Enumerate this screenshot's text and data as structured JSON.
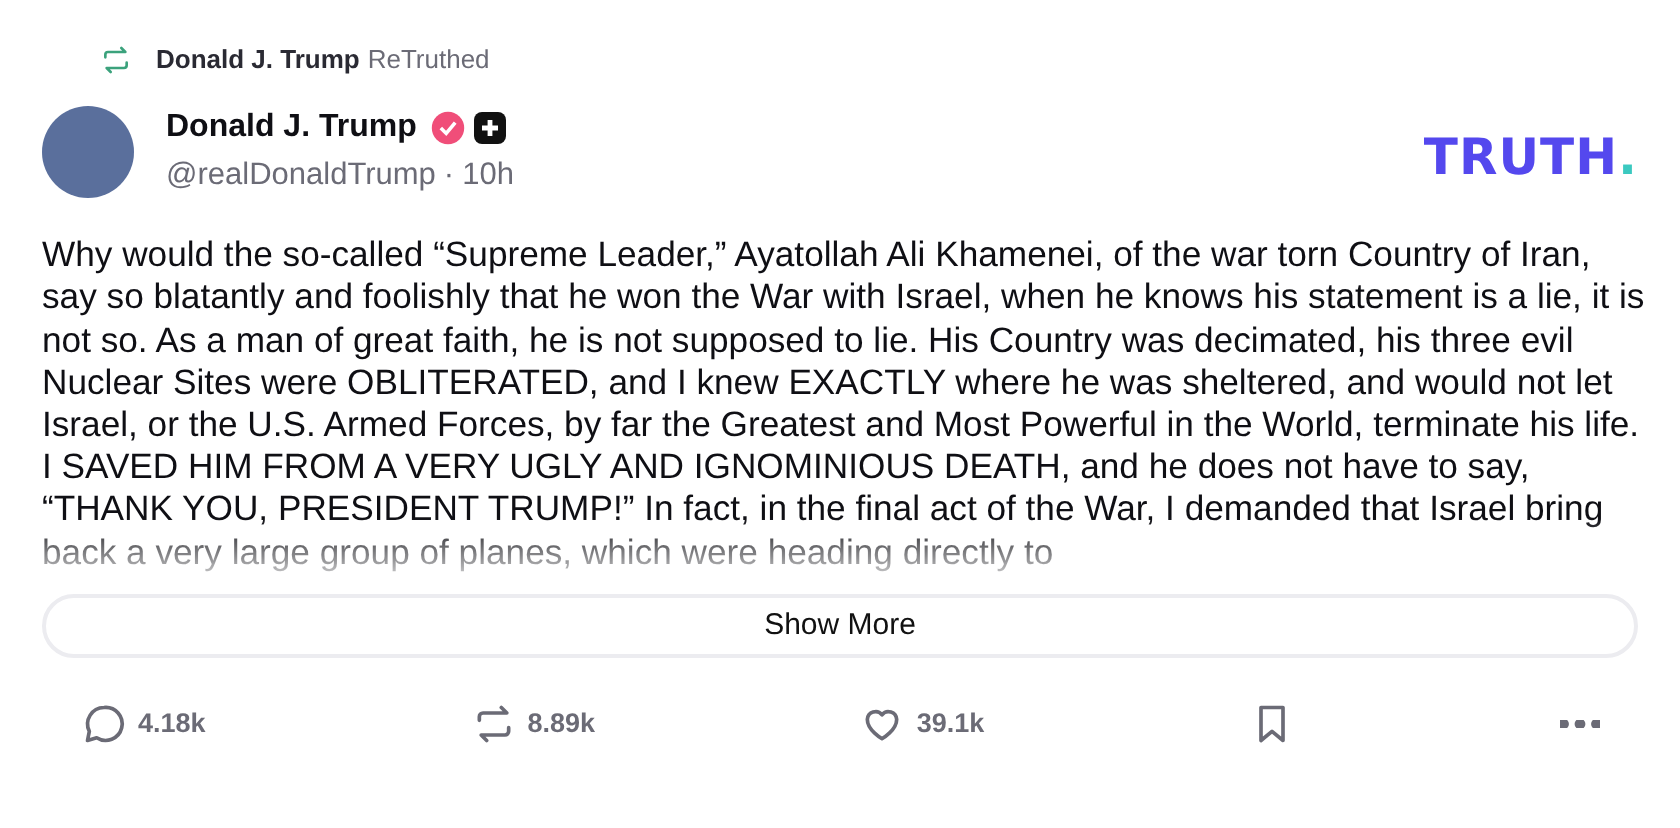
{
  "retruth_bar": {
    "name": "Donald J. Trump",
    "action": "ReTruthed"
  },
  "author": {
    "name": "Donald J. Trump",
    "verified": true,
    "plus": true,
    "handle": "@realDonaldTrump",
    "separator": "·",
    "time": "10h"
  },
  "logo": "TRUTH.",
  "post": {
    "text": "Why would the so-called “Supreme Leader,” Ayatollah Ali Khamenei, of the war torn Country of Iran, say so blatantly and foolishly that he won the War with Israel, when he knows his statement is a lie, it is not so. As a man of great faith, he is not supposed to lie. His Country was decimated, his three evil Nuclear Sites were OBLITERATED, and I knew EXACTLY where he was sheltered, and would not let Israel, or the U.S. Armed Forces, by far the Greatest and Most Powerful in the World, terminate his life. I SAVED HIM FROM A VERY UGLY AND IGNOMINIOUS DEATH, and he does not have to say, “THANK YOU, PRESIDENT TRUMP!” In fact, in the final act of the War, I demanded that Israel bring back a very large group of planes, which were heading directly to",
    "truncated": true
  },
  "show_more": "Show More",
  "actions": [
    {
      "kind": "reply",
      "count": "4.18k"
    },
    {
      "kind": "retruth",
      "count": "8.89k"
    },
    {
      "kind": "like",
      "count": "39.1k"
    },
    {
      "kind": "bookmark"
    },
    {
      "kind": "more"
    }
  ]
}
